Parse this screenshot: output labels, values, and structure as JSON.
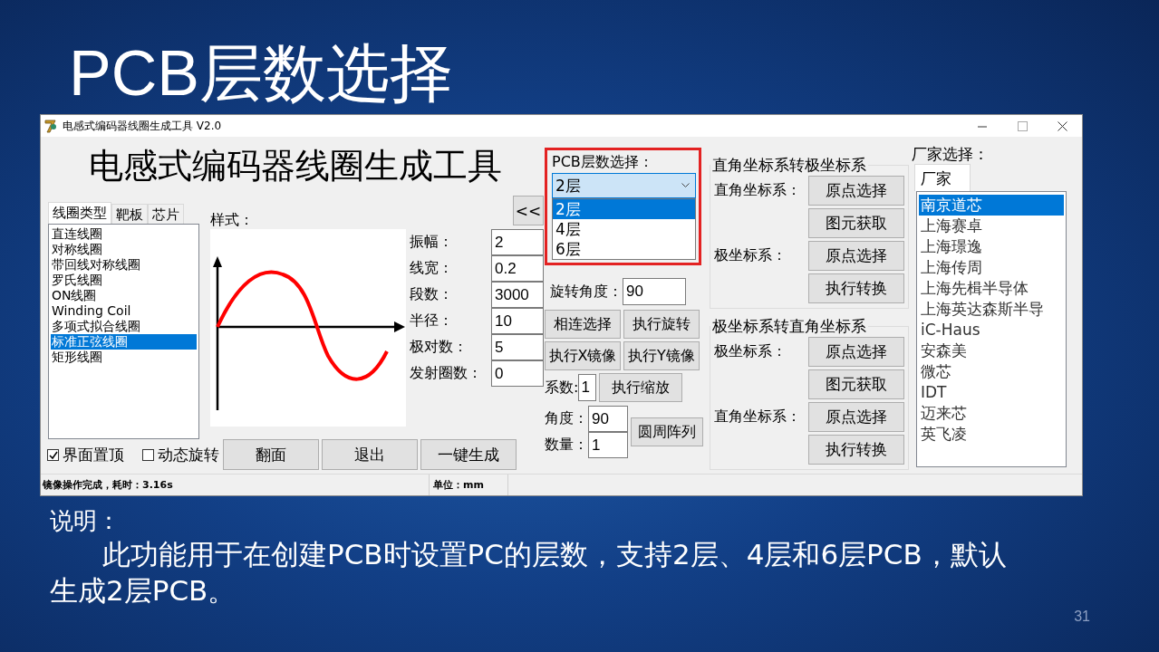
{
  "slide": {
    "title": "PCB层数选择",
    "caption_heading": "说明：",
    "caption": "此功能用于在创建PCB时设置PC的层数，支持2层、4层和6层PCB，默认生成2层PCB。",
    "page_number": "31"
  },
  "window": {
    "title": "电感式编码器线圈生成工具 V2.0",
    "app_heading": "电感式编码器线圈生成工具",
    "collapse_button": "<<",
    "coil_tabs": [
      {
        "label": "线圈类型",
        "selected": true
      },
      {
        "label": "靶板",
        "selected": false
      },
      {
        "label": "芯片",
        "selected": false
      }
    ],
    "coil_types": [
      {
        "label": "直连线圈",
        "selected": false
      },
      {
        "label": "对称线圈",
        "selected": false
      },
      {
        "label": "带回线对称线圈",
        "selected": false
      },
      {
        "label": "罗氏线圈",
        "selected": false
      },
      {
        "label": "ON线圈",
        "selected": false
      },
      {
        "label": "Winding Coil",
        "selected": false
      },
      {
        "label": "多项式拟合线圈",
        "selected": false
      },
      {
        "label": "标准正弦线圈",
        "selected": true
      },
      {
        "label": "矩形线圈",
        "selected": false
      }
    ],
    "style_label": "样式：",
    "parameters": [
      {
        "label": "振幅：",
        "value": "2"
      },
      {
        "label": "线宽：",
        "value": "0.2"
      },
      {
        "label": "段数：",
        "value": "3000"
      },
      {
        "label": "半径：",
        "value": "10"
      },
      {
        "label": "极对数：",
        "value": "5"
      },
      {
        "label": "发射圈数：",
        "value": "0"
      }
    ],
    "options": [
      {
        "label": "界面置顶",
        "checked": true
      },
      {
        "label": "动态旋转",
        "checked": false
      }
    ],
    "actions": [
      "翻面",
      "退出",
      "一键生成"
    ],
    "pcb_layers": {
      "label": "PCB层数选择：",
      "value": "2层",
      "highlighted": true,
      "options": [
        {
          "label": "2层",
          "selected": true
        },
        {
          "label": "4层",
          "selected": false
        },
        {
          "label": "6层",
          "selected": false
        }
      ]
    },
    "rotation": {
      "label": "旋转角度：",
      "value": "90"
    },
    "transform_buttons": [
      "相连选择",
      "执行旋转",
      "执行X镜像",
      "执行Y镜像"
    ],
    "scale": {
      "label": "系数:",
      "value": "1",
      "button": "执行缩放"
    },
    "array": {
      "angle_label": "角度：",
      "angle_value": "90",
      "count_label": "数量：",
      "count_value": "1",
      "button": "圆周阵列"
    },
    "coordinate_groups": [
      {
        "title": "直角坐标系转极坐标系",
        "rows": [
          {
            "label": "直角坐标系：",
            "button": "原点选择"
          },
          {
            "label": "",
            "button": "图元获取"
          },
          {
            "label": "极坐标系：",
            "button": "原点选择"
          },
          {
            "label": "",
            "button": "执行转换"
          }
        ]
      },
      {
        "title": "极坐标系转直角坐标系",
        "rows": [
          {
            "label": "极坐标系：",
            "button": "原点选择"
          },
          {
            "label": "",
            "button": "图元获取"
          },
          {
            "label": "直角坐标系：",
            "button": "原点选择"
          },
          {
            "label": "",
            "button": "执行转换"
          }
        ]
      }
    ],
    "vendor": {
      "label": "厂家选择：",
      "tab": "厂家",
      "items": [
        {
          "label": "南京道芯",
          "selected": true
        },
        {
          "label": "上海赛卓",
          "selected": false
        },
        {
          "label": "上海璟逸",
          "selected": false
        },
        {
          "label": "上海传周",
          "selected": false
        },
        {
          "label": "上海先楫半导体",
          "selected": false
        },
        {
          "label": "上海英达森斯半导",
          "selected": false
        },
        {
          "label": "iC-Haus",
          "selected": false
        },
        {
          "label": "安森美",
          "selected": false
        },
        {
          "label": "微芯",
          "selected": false
        },
        {
          "label": "IDT",
          "selected": false
        },
        {
          "label": "迈来芯",
          "selected": false
        },
        {
          "label": "英飞凌",
          "selected": false
        }
      ]
    },
    "status_bar": {
      "message": "镜像操作完成，耗时：3.16s",
      "unit": "单位：mm"
    }
  }
}
